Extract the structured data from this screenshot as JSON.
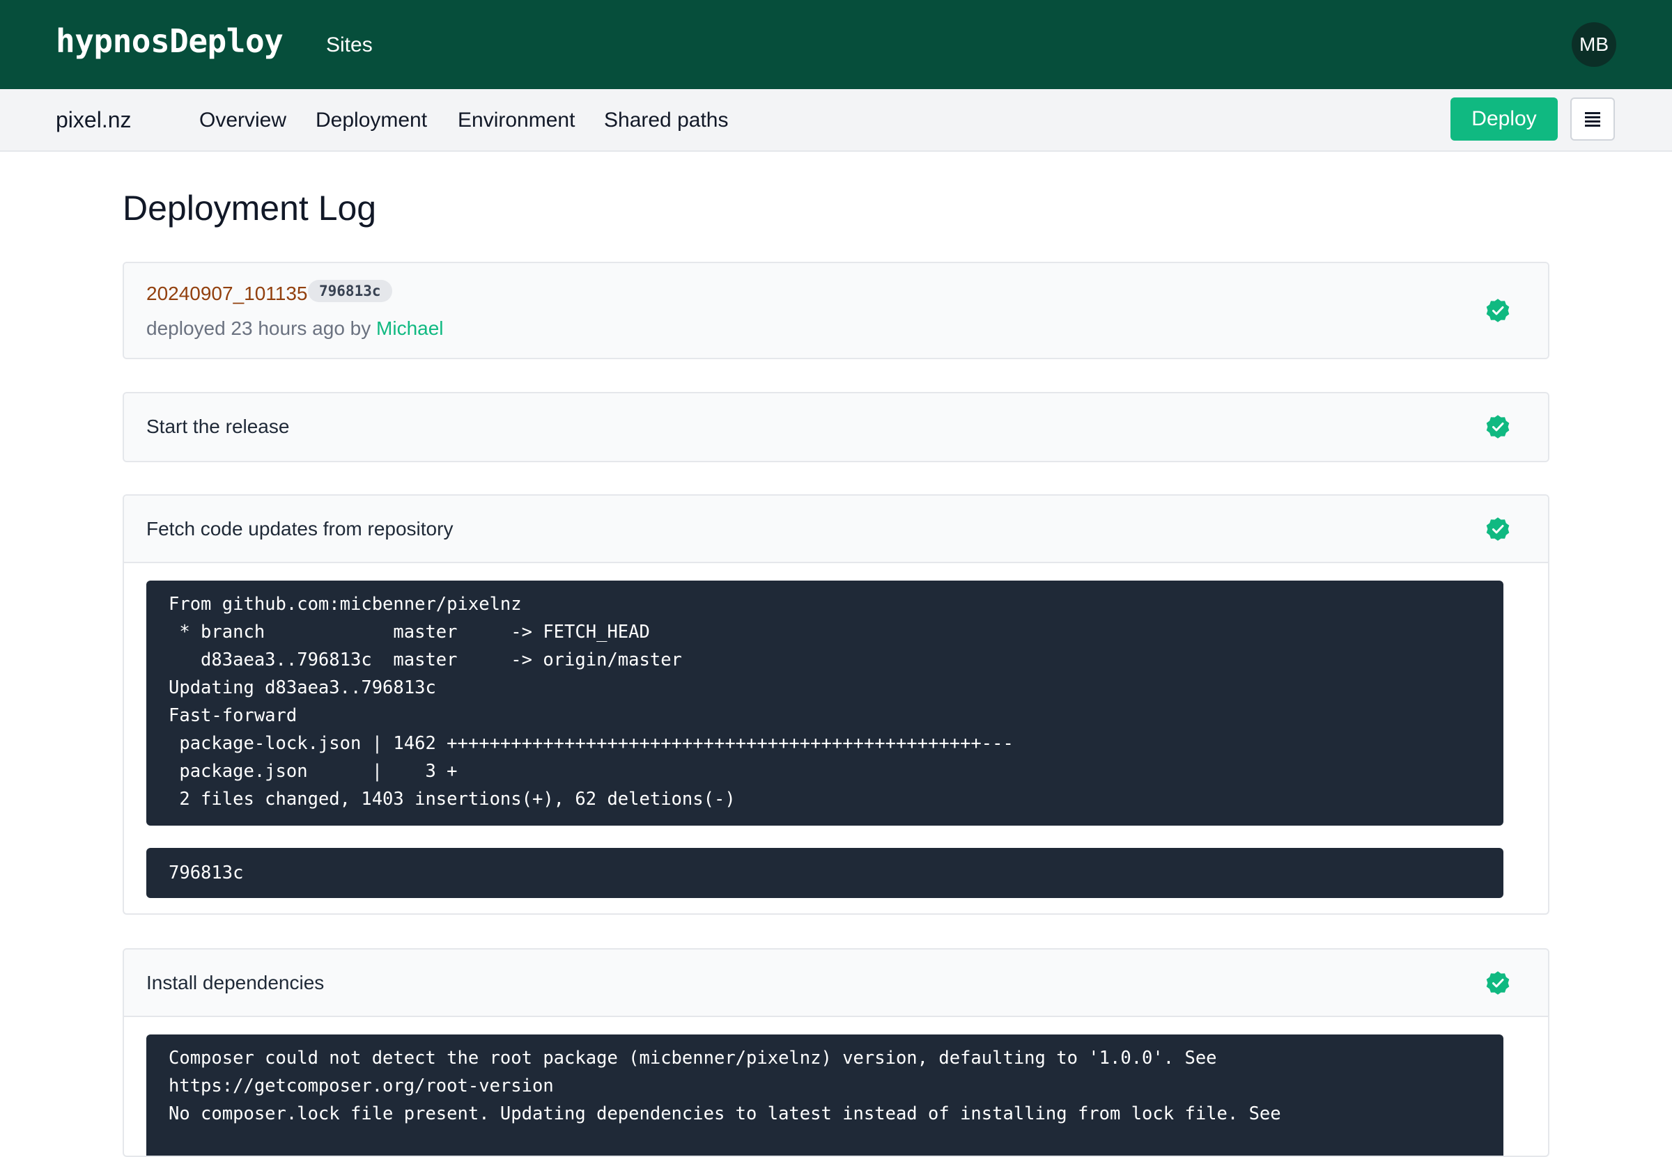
{
  "app": {
    "brand": "hypnosDeploy",
    "nav_sites": "Sites",
    "avatar_initials": "MB"
  },
  "subnav": {
    "site_name": "pixel.nz",
    "tabs": [
      "Overview",
      "Deployment",
      "Environment",
      "Shared paths"
    ],
    "deploy_label": "Deploy"
  },
  "page": {
    "title": "Deployment Log"
  },
  "release": {
    "id": "20240907_101135",
    "hash": "796813c",
    "deployed_prefix": "deployed 23 hours ago by ",
    "deployed_by": "Michael"
  },
  "steps": [
    {
      "title": "Start the release"
    },
    {
      "title": "Fetch code updates from repository",
      "outputs": [
        "From github.com:micbenner/pixelnz\n * branch            master     -> FETCH_HEAD\n   d83aea3..796813c  master     -> origin/master\nUpdating d83aea3..796813c\nFast-forward\n package-lock.json | 1462 ++++++++++++++++++++++++++++++++++++++++++++++++++---\n package.json      |    3 +\n 2 files changed, 1403 insertions(+), 62 deletions(-)",
        "796813c"
      ]
    },
    {
      "title": "Install dependencies",
      "outputs": [
        "Composer could not detect the root package (micbenner/pixelnz) version, defaulting to '1.0.0'. See\nhttps://getcomposer.org/root-version\nNo composer.lock file present. Updating dependencies to latest instead of installing from lock file. See"
      ]
    }
  ],
  "colors": {
    "topbar": "#064e3b",
    "accent": "#10b981",
    "release_id": "#92400e",
    "code_bg": "#1f2937"
  },
  "icons": {
    "status": "check-badge-icon",
    "menu": "menu-icon"
  }
}
